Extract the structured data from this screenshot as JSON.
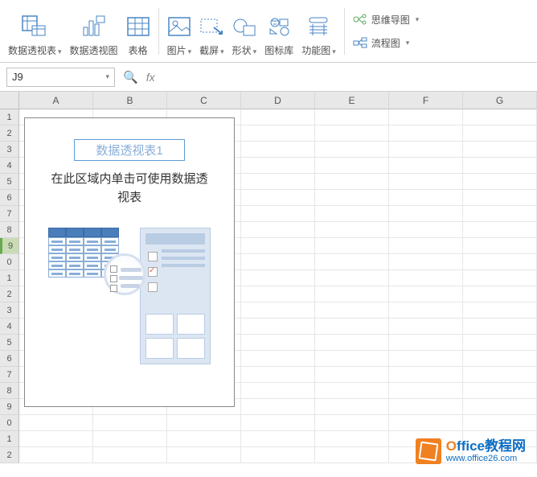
{
  "ribbon": {
    "pivot_table": "数据透视表",
    "pivot_chart": "数据透视图",
    "table": "表格",
    "picture": "图片",
    "screenshot": "截屏",
    "shapes": "形状",
    "icon_lib": "图标库",
    "function_chart": "功能图",
    "mindmap": "思维导图",
    "flowchart": "流程图"
  },
  "namebox": {
    "value": "J9"
  },
  "fx": {
    "label": "fx"
  },
  "columns": [
    "A",
    "B",
    "C",
    "D",
    "E",
    "F",
    "G"
  ],
  "rows": [
    "1",
    "2",
    "3",
    "4",
    "5",
    "6",
    "7",
    "8",
    "9",
    "0",
    "1",
    "2",
    "3",
    "4",
    "5",
    "6",
    "7",
    "8",
    "9",
    "0",
    "1",
    "2"
  ],
  "pivot": {
    "title": "数据透视表1",
    "hint_l1": "在此区域内单击可使用数据透",
    "hint_l2": "视表"
  },
  "watermark": {
    "brand_orange": "O",
    "brand_rest": "ffice教程网",
    "url": "www.office26.com"
  }
}
